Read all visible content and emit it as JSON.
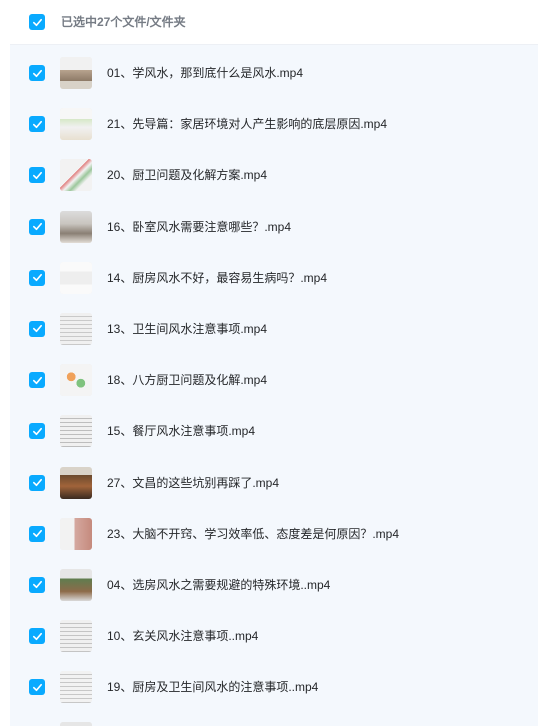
{
  "header": {
    "selection_label": "已选中27个文件/文件夹"
  },
  "colors": {
    "checkbox": "#09aaff",
    "list_bg": "#f4f8fd",
    "text": "#25272a",
    "header_text": "#767c85"
  },
  "files": [
    {
      "name": "01、学风水，那到底什么是风水.mp4",
      "checked": true,
      "icon": "video-thumbnail"
    },
    {
      "name": "21、先导篇：家居环境对人产生影响的底层原因.mp4",
      "checked": true,
      "icon": "video-thumbnail"
    },
    {
      "name": "20、厨卫问题及化解方案.mp4",
      "checked": true,
      "icon": "video-thumbnail"
    },
    {
      "name": "16、卧室风水需要注意哪些？.mp4",
      "checked": true,
      "icon": "video-thumbnail"
    },
    {
      "name": "14、厨房风水不好，最容易生病吗？.mp4",
      "checked": true,
      "icon": "video-thumbnail"
    },
    {
      "name": "13、卫生间风水注意事项.mp4",
      "checked": true,
      "icon": "video-thumbnail"
    },
    {
      "name": "18、八方厨卫问题及化解.mp4",
      "checked": true,
      "icon": "video-thumbnail"
    },
    {
      "name": "15、餐厅风水注意事项.mp4",
      "checked": true,
      "icon": "video-thumbnail"
    },
    {
      "name": "27、文昌的这些坑别再踩了.mp4",
      "checked": true,
      "icon": "video-thumbnail"
    },
    {
      "name": "23、大脑不开窍、学习效率低、态度差是何原因？.mp4",
      "checked": true,
      "icon": "video-thumbnail"
    },
    {
      "name": "04、选房风水之需要规避的特殊环境..mp4",
      "checked": true,
      "icon": "video-thumbnail"
    },
    {
      "name": "10、玄关风水注意事项..mp4",
      "checked": true,
      "icon": "video-thumbnail"
    },
    {
      "name": "19、厨房及卫生间风水的注意事项..mp4",
      "checked": true,
      "icon": "video-thumbnail"
    },
    {
      "name": "",
      "checked": false,
      "icon": "video-thumbnail"
    }
  ]
}
